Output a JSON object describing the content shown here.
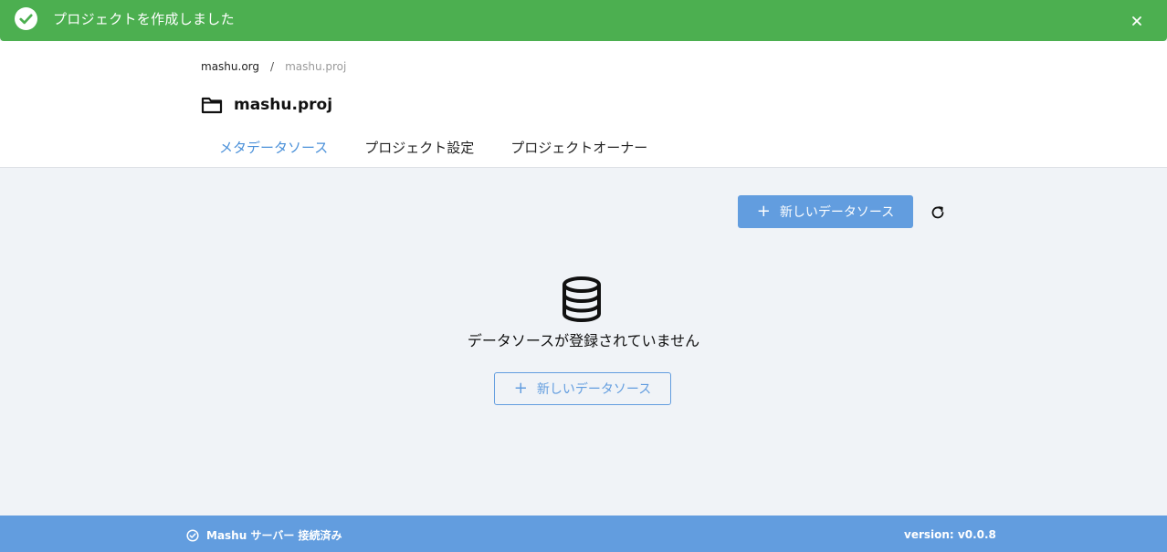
{
  "toast": {
    "message": "プロジェクトを作成しました",
    "icon": "check-circle-icon",
    "close_icon": "close-icon",
    "color": "#4caf50"
  },
  "breadcrumb": {
    "org": "mashu.org",
    "separator": "/",
    "project": "mashu.proj"
  },
  "page": {
    "title": "mashu.proj",
    "title_icon": "folder-icon"
  },
  "tabs": [
    {
      "label": "メタデータソース",
      "active": true
    },
    {
      "label": "プロジェクト設定",
      "active": false
    },
    {
      "label": "プロジェクトオーナー",
      "active": false
    }
  ],
  "toolbar": {
    "new_datasource_label": "新しいデータソース",
    "plus": "+",
    "refresh_icon": "refresh-icon"
  },
  "empty_state": {
    "icon": "database-icon",
    "message": "データソースが登録されていません",
    "button_label": "新しいデータソース",
    "plus": "+"
  },
  "footer": {
    "status": "Mashu サーバー 接続済み",
    "status_icon": "check-circle-outline-icon",
    "version": "version: v0.0.8"
  },
  "colors": {
    "accent": "#629ddf",
    "active_tab": "#4a90d9",
    "success": "#4caf50",
    "background": "#f0f3f7"
  }
}
